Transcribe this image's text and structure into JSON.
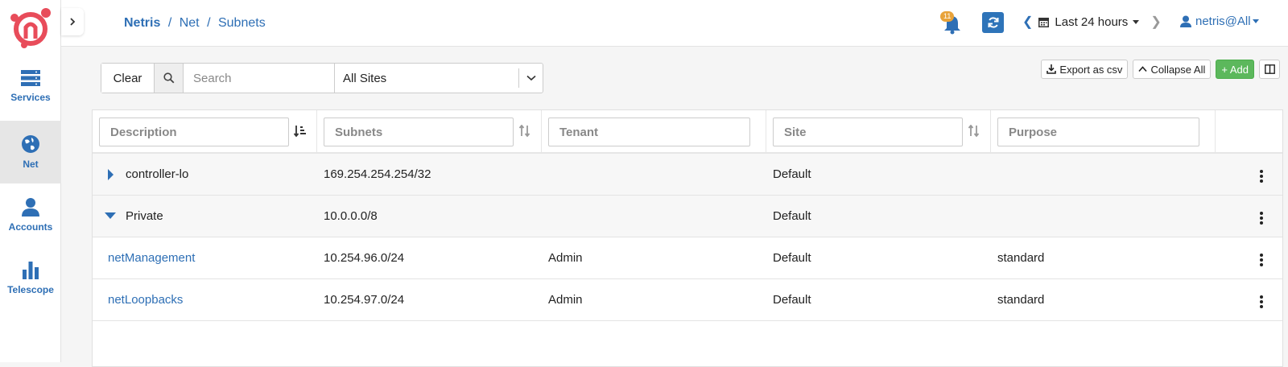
{
  "sidebar": {
    "items": [
      {
        "label": "Services",
        "icon": "server-icon"
      },
      {
        "label": "Net",
        "icon": "globe-icon"
      },
      {
        "label": "Accounts",
        "icon": "user-icon"
      },
      {
        "label": "Telescope",
        "icon": "bar-chart-icon"
      }
    ]
  },
  "breadcrumb": {
    "root": "Netris",
    "sep1": "/",
    "level1": "Net",
    "sep2": "/",
    "level2": "Subnets"
  },
  "header": {
    "notification_count": "11",
    "time_range": "Last 24 hours",
    "user": "netris@All"
  },
  "toolbar": {
    "clear_label": "Clear",
    "search_placeholder": "Search",
    "site_value": "All Sites",
    "export_label": "Export as csv",
    "collapse_label": "Collapse All",
    "add_label": "+ Add"
  },
  "table": {
    "columns": [
      "Description",
      "Subnets",
      "Tenant",
      "Site",
      "Purpose"
    ],
    "rows": [
      {
        "description": "controller-lo",
        "subnet": "169.254.254.254/32",
        "tenant": "",
        "site": "Default",
        "purpose": ""
      },
      {
        "description": "Private",
        "subnet": "10.0.0.0/8",
        "tenant": "",
        "site": "Default",
        "purpose": ""
      },
      {
        "description": "netManagement",
        "subnet": "10.254.96.0/24",
        "tenant": "Admin",
        "site": "Default",
        "purpose": "standard"
      },
      {
        "description": "netLoopbacks",
        "subnet": "10.254.97.0/24",
        "tenant": "Admin",
        "site": "Default",
        "purpose": "standard"
      }
    ]
  },
  "colors": {
    "accent": "#2e6fb5",
    "logo": "#e84c5a",
    "add": "#5cb85c",
    "badge": "#e8a33a"
  }
}
